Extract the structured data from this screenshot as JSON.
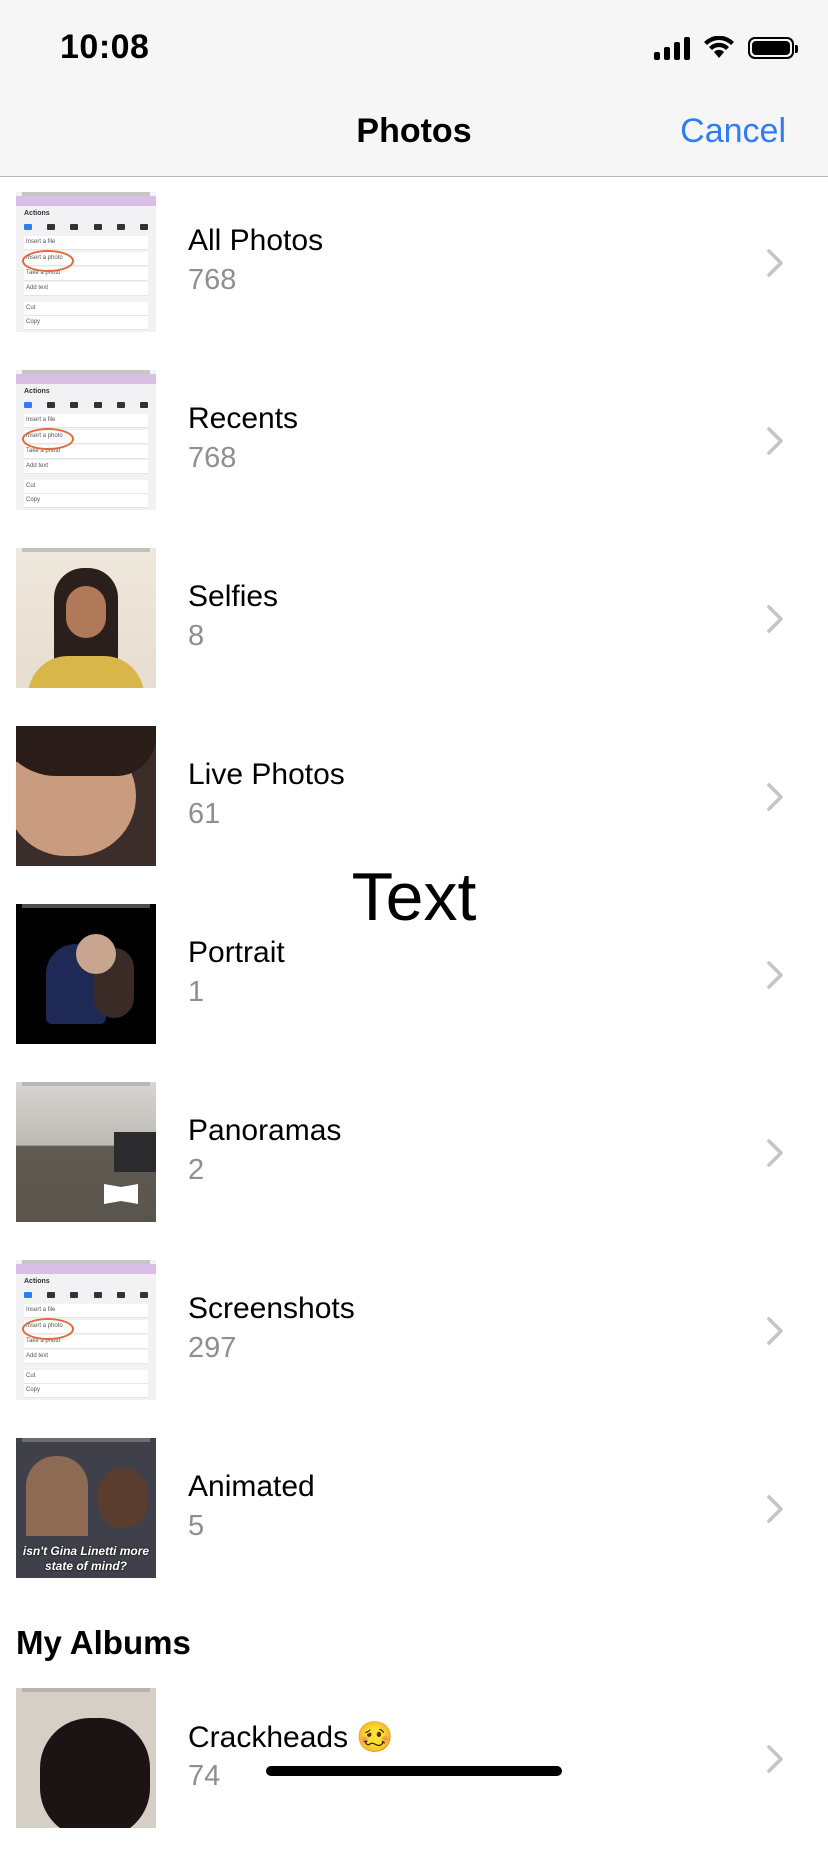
{
  "status": {
    "time": "10:08"
  },
  "nav": {
    "title": "Photos",
    "cancel": "Cancel"
  },
  "albums": [
    {
      "label": "All Photos",
      "count": "768"
    },
    {
      "label": "Recents",
      "count": "768"
    },
    {
      "label": "Selfies",
      "count": "8"
    },
    {
      "label": "Live Photos",
      "count": "61"
    },
    {
      "label": "Portrait",
      "count": "1"
    },
    {
      "label": "Panoramas",
      "count": "2"
    },
    {
      "label": "Screenshots",
      "count": "297"
    },
    {
      "label": "Animated",
      "count": "5"
    }
  ],
  "thumb_text": {
    "actions": "Actions",
    "insert_file": "Insert a file",
    "insert_photo": "Insert a photo",
    "take_photo": "Take a photo",
    "add_text": "Add text",
    "cut": "Cut",
    "copy": "Copy",
    "gif_caption": "isn't Gina Linetti more state of mind?"
  },
  "my_albums": {
    "title": "My Albums",
    "items": [
      {
        "label": "Crackheads 🥴",
        "count": "74"
      }
    ]
  },
  "overlay": "Text",
  "colors": {
    "accent": "#2f7cf6",
    "secondary_text": "#8e8e93",
    "bar_bg": "#f6f6f6"
  }
}
